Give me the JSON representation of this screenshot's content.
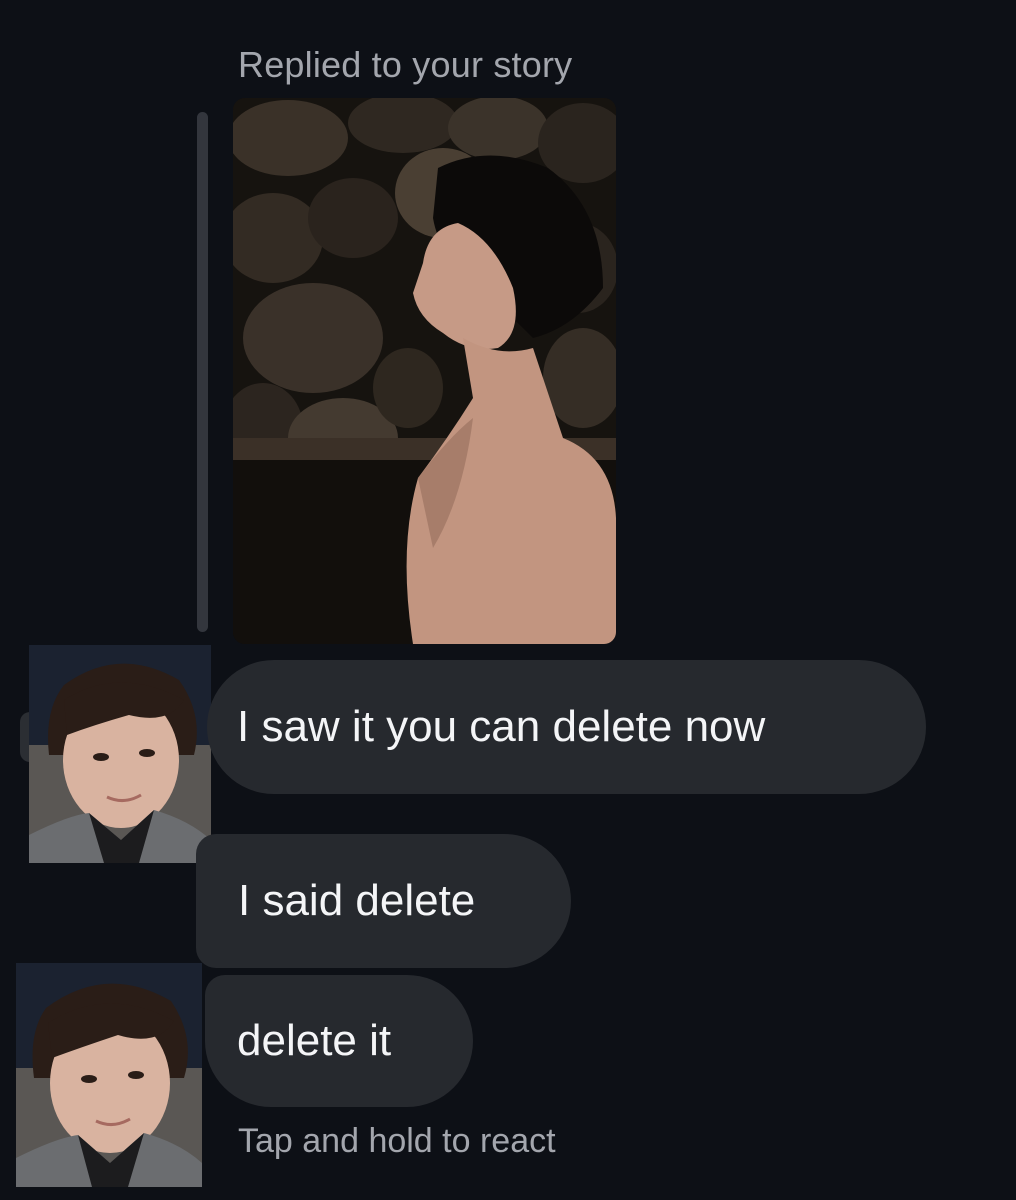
{
  "reply_header": {
    "label": "Replied to your story"
  },
  "story": {
    "image_icon": "story-photo-thumbnail"
  },
  "messages": [
    {
      "text": "I saw it you can delete now"
    },
    {
      "text": "I said delete"
    },
    {
      "text": "delete it"
    }
  ],
  "footer": {
    "hint": "Tap and hold to react"
  },
  "colors": {
    "background": "#0d1016",
    "bubble": "#26292e",
    "muted_text": "#a3a6ad",
    "reply_bar": "#33363d"
  }
}
